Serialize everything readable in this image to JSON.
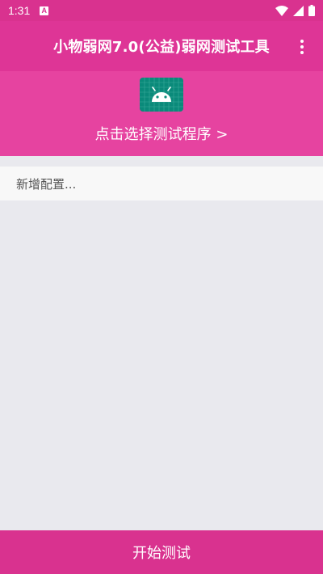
{
  "status_bar": {
    "time": "1:31",
    "notification_icon": "A",
    "icons": [
      "wifi-icon",
      "signal-icon",
      "battery-icon"
    ]
  },
  "app_bar": {
    "title": "小物弱网7.0(公益)弱网测试工具",
    "menu_icon": "more-vert-icon"
  },
  "selector": {
    "icon": "android-icon",
    "label": "点击选择测试程序 >"
  },
  "config": {
    "new_config_label": "新增配置..."
  },
  "footer": {
    "start_button_label": "开始测试"
  },
  "colors": {
    "status_bar": "#d9328f",
    "app_bar": "#de3596",
    "selector_bg": "#e643a0",
    "content_bg": "#e9e9ee",
    "button": "#d9328f",
    "icon_bg": "#0a8a7a"
  }
}
